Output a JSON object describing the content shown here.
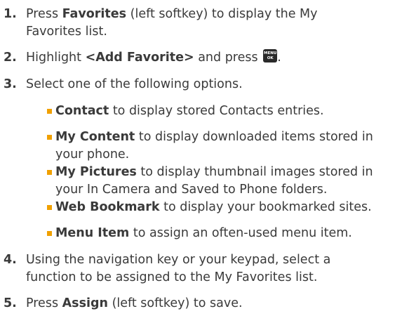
{
  "steps": [
    {
      "number": "1.",
      "pre": "Press ",
      "bold": "Favorites",
      "post": " (left softkey) to display the My",
      "line2": "Favorites list."
    },
    {
      "number": "2.",
      "pre": "Highlight ",
      "bold": "<Add Favorite>",
      "post": " and press ",
      "key_icon": "menu-ok-key-icon",
      "key_top": "MENU",
      "key_bottom": "OK",
      "end": "."
    },
    {
      "number": "3.",
      "text": "Select one of the following options."
    },
    {
      "number": "4.",
      "line1": "Using the navigation key or your keypad, select a",
      "line2": "function to be assigned to the My Favorites list."
    },
    {
      "number": "5.",
      "pre": "Press ",
      "bold": "Assign",
      "post": " (left softkey) to save."
    }
  ],
  "options": [
    {
      "bold": "Contact",
      "post": " to display stored Contacts entries."
    },
    {
      "bold": "My Content",
      "post": " to display downloaded items stored in",
      "line2": "your phone."
    },
    {
      "bold": "My Pictures",
      "post": " to display thumbnail images stored in",
      "line2": "your In Camera and Saved to Phone folders."
    },
    {
      "bold": "Web Bookmark",
      "post": " to display your bookmarked sites."
    },
    {
      "bold": "Menu Item",
      "post": " to assign an often-used menu item."
    }
  ],
  "colors": {
    "text": "#3a3a3a",
    "bullet": "#f0a000",
    "key_background": "#2a2a2a"
  }
}
